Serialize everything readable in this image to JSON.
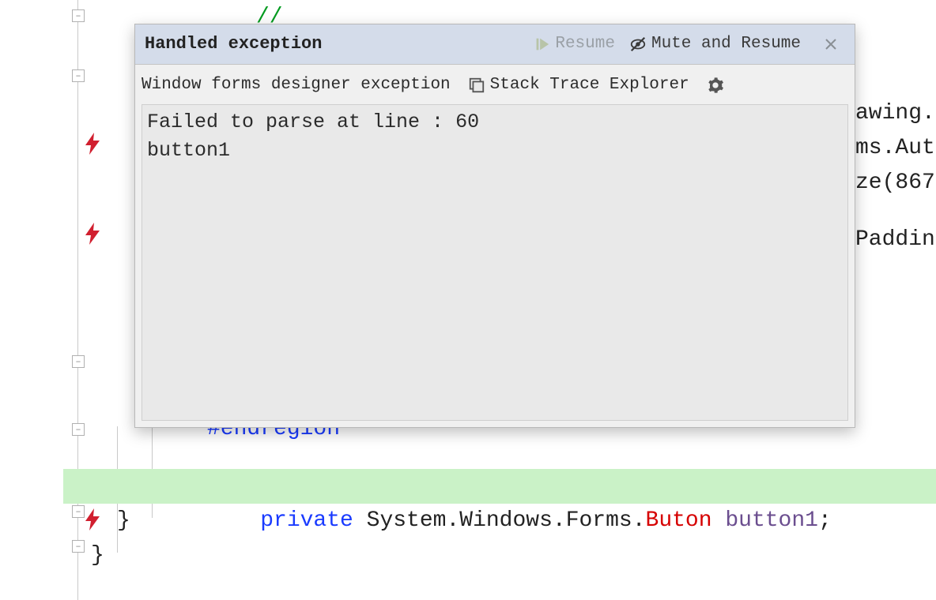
{
  "popup": {
    "title": "Handled exception",
    "resume": "Resume",
    "mute_resume": "Mute and Resume",
    "subtitle": "Window forms designer exception",
    "stack_trace": "Stack Trace Explorer",
    "body": "Failed to parse at line : 60\nbutton1"
  },
  "code": {
    "slashslash": "//",
    "endregion": "#endregion",
    "private": "private",
    "sys": " System.Windows.Forms.",
    "err": "Buton",
    "ident": " button1",
    "semi": ";",
    "brace": "}",
    "partial1": "awing.",
    "partial2": "ms.Aut",
    "partial3": "ze(867",
    "partial4": "Paddin"
  }
}
